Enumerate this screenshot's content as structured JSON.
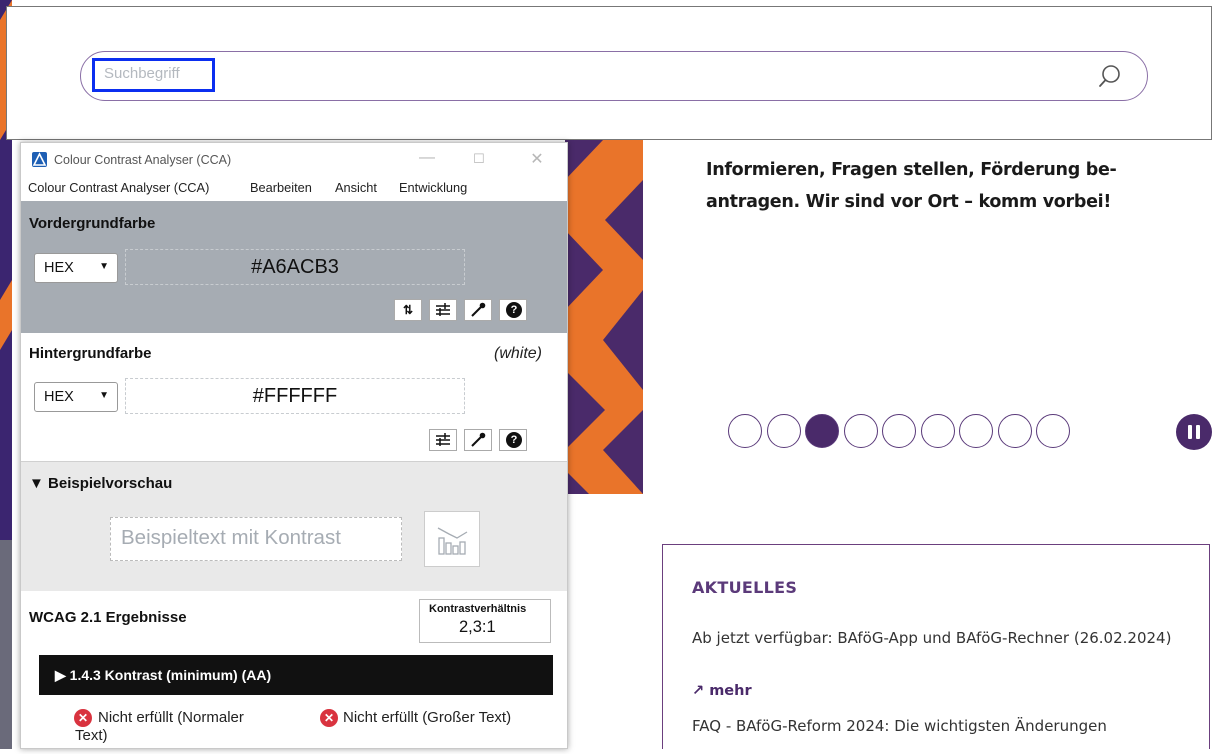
{
  "site": {
    "search": {
      "placeholder": "Suchbegriff"
    },
    "hero": {
      "text": "Informieren, Fragen stellen, Förderung be- antragen. Wir sind vor Ort – komm vorbei!"
    },
    "carousel": {
      "total": 9,
      "active": 3
    },
    "news": {
      "title": "AKTUELLES",
      "item1": "Ab jetzt verfügbar: BAföG-App und BAföG-Rechner (26.02.2024)",
      "more": "↗ mehr",
      "item2": "FAQ - BAföG-Reform 2024: Die wichtigsten Änderungen"
    },
    "colors": {
      "brand": "#4a2a6a",
      "accent": "#e9742a",
      "focus": "#0b2ef0"
    }
  },
  "cca": {
    "title": "Colour Contrast Analyser (CCA)",
    "window_controls": [
      "—",
      "☐",
      "✕"
    ],
    "menu": [
      "Colour Contrast Analyser (CCA)",
      "Bearbeiten",
      "Ansicht",
      "Entwicklung"
    ],
    "foreground": {
      "label": "Vordergrundfarbe",
      "format": "HEX",
      "value": "#A6ACB3"
    },
    "background": {
      "label": "Hintergrundfarbe",
      "name": "(white)",
      "format": "HEX",
      "value": "#FFFFFF"
    },
    "preview": {
      "label": "▼ Beispielvorschau",
      "text": "Beispieltext mit Kontrast"
    },
    "results": {
      "label": "WCAG 2.1 Ergebnisse",
      "ratio_label": "Kontrastverhältnis",
      "ratio_value": "2,3:1",
      "criterion": "▶ 1.4.3 Kontrast (minimum) (AA)",
      "normal_text": "Nicht erfüllt (Normaler Text)",
      "large_text": "Nicht erfüllt (Großer Text)"
    }
  }
}
